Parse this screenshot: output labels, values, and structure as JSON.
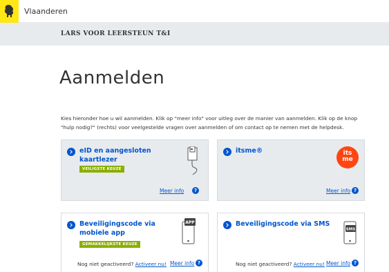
{
  "header": {
    "brand": "Vlaanderen"
  },
  "subheader": {
    "title": "LARS VOOR LEERSTEUN T&I"
  },
  "main": {
    "title": "Aanmelden",
    "intro": "Kies hieronder hoe u wil aanmelden. Klik op \"meer info\" voor uitleg over de manier van aanmelden. Klik op de knop \"hulp nodig?\" (rechts) voor veelgestelde vragen over aanmelden of om contact op te nemen met de helpdesk."
  },
  "options": [
    {
      "title": "eID en aangesloten kaartlezer",
      "tag": "VEILIGSTE KEUZE",
      "more": "Meer info",
      "help": "?"
    },
    {
      "title": "itsme®",
      "logo_line1": "its",
      "logo_line2": "me",
      "more": "Meer info",
      "help": "?"
    },
    {
      "title": "Beveiligingscode via mobiele app",
      "tag": "GEMAKKELIJKSTE KEUZE",
      "device_label": "APP",
      "note": "Nog niet geactiveerd?",
      "activate": "Activeer nu!",
      "more": "Meer info",
      "help": "?"
    },
    {
      "title": "Beveiligingscode via SMS",
      "device_label": "SMS",
      "note": "Nog niet geactiveerd?",
      "activate": "Activeer nu!",
      "more": "Meer info",
      "help": "?"
    }
  ],
  "colors": {
    "accent": "#0055cc",
    "tag": "#8bae00",
    "itsme": "#ff4612",
    "logo": "#ffe615",
    "panel": "#e8ebee"
  }
}
